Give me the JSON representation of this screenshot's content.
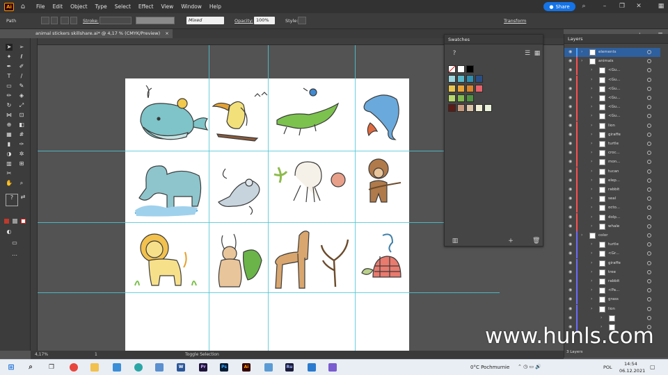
{
  "app": {
    "logo": "Ai",
    "menus": [
      "File",
      "Edit",
      "Object",
      "Type",
      "Select",
      "Effect",
      "View",
      "Window",
      "Help"
    ],
    "share_label": "Share"
  },
  "control": {
    "selection_type": "Path",
    "stroke_label": "Stroke:",
    "mixed_value": "Mixed",
    "opacity_label": "Opacity:",
    "opacity_value": "100%",
    "style_label": "Style:",
    "transform_label": "Transform"
  },
  "document": {
    "tab_title": "animal stickers skillshare.ai* @ 4,17 % (CMYK/Preview)",
    "close": "×"
  },
  "status": {
    "zoom": "4,17%",
    "page": "1",
    "tool": "Toggle Selection"
  },
  "swatches_panel": {
    "title": "Swatches",
    "rows": [
      [
        "#ffffff",
        "#ffffff",
        "#000000"
      ],
      [
        "#9dd7df",
        "#59b6c9",
        "#2e8fb0",
        "#2a4f86"
      ],
      [
        "#e9c74e",
        "#e7a436",
        "#d9832c",
        "#e7626b"
      ],
      [
        "#b6d86d",
        "#7fba4d",
        "#4f9440"
      ],
      [
        "#5e1a14",
        "#c99a7d",
        "#dcc4a6",
        "#f2f0d4",
        "#eaf3d9"
      ]
    ]
  },
  "layers_panel": {
    "title": "Layers",
    "footer": "3 Layers",
    "rows": [
      {
        "name": "elements",
        "indent": 0,
        "color": "#4ea3ff",
        "selected": true
      },
      {
        "name": "animals",
        "indent": 0,
        "color": "#ff4f4f"
      },
      {
        "name": "<Gu...",
        "indent": 1,
        "color": "#ff4f4f"
      },
      {
        "name": "<Gu...",
        "indent": 1,
        "color": "#ff4f4f"
      },
      {
        "name": "<Gu...",
        "indent": 1,
        "color": "#ff4f4f"
      },
      {
        "name": "<Gu...",
        "indent": 1,
        "color": "#ff4f4f"
      },
      {
        "name": "<Gu...",
        "indent": 1,
        "color": "#ff4f4f"
      },
      {
        "name": "<Gu...",
        "indent": 1,
        "color": "#ff4f4f"
      },
      {
        "name": "lion",
        "indent": 1,
        "color": "#ff4f4f"
      },
      {
        "name": "giraffe",
        "indent": 1,
        "color": "#ff4f4f"
      },
      {
        "name": "turtle",
        "indent": 1,
        "color": "#ff4f4f"
      },
      {
        "name": "croc...",
        "indent": 1,
        "color": "#ff4f4f"
      },
      {
        "name": "mon...",
        "indent": 1,
        "color": "#ff4f4f"
      },
      {
        "name": "tucan",
        "indent": 1,
        "color": "#ff4f4f"
      },
      {
        "name": "elep...",
        "indent": 1,
        "color": "#ff4f4f"
      },
      {
        "name": "rabbit",
        "indent": 1,
        "color": "#ff4f4f"
      },
      {
        "name": "seal",
        "indent": 1,
        "color": "#ff4f4f"
      },
      {
        "name": "octo...",
        "indent": 1,
        "color": "#ff4f4f"
      },
      {
        "name": "dolp...",
        "indent": 1,
        "color": "#ff4f4f"
      },
      {
        "name": "whale",
        "indent": 1,
        "color": "#ff4f4f"
      },
      {
        "name": "color",
        "indent": 0,
        "color": "#6a6aff"
      },
      {
        "name": "turtle",
        "indent": 1,
        "color": "#6a6aff"
      },
      {
        "name": "<Gr...",
        "indent": 1,
        "color": "#6a6aff"
      },
      {
        "name": "giraffe",
        "indent": 1,
        "color": "#6a6aff"
      },
      {
        "name": "tree",
        "indent": 1,
        "color": "#6a6aff"
      },
      {
        "name": "rabbit",
        "indent": 1,
        "color": "#6a6aff"
      },
      {
        "name": "<Pa...",
        "indent": 1,
        "color": "#6a6aff"
      },
      {
        "name": "grass",
        "indent": 1,
        "color": "#6a6aff"
      },
      {
        "name": "lion",
        "indent": 1,
        "color": "#6a6aff"
      },
      {
        "name": "",
        "indent": 2,
        "color": "#6a6aff"
      },
      {
        "name": "",
        "indent": 2,
        "color": "#6a6aff"
      }
    ]
  },
  "taskbar": {
    "weather": "0°C Pochmurnie",
    "lang": "POL",
    "time": "14:54",
    "date": "06.12.2021"
  },
  "watermark": "www.hunls.com"
}
